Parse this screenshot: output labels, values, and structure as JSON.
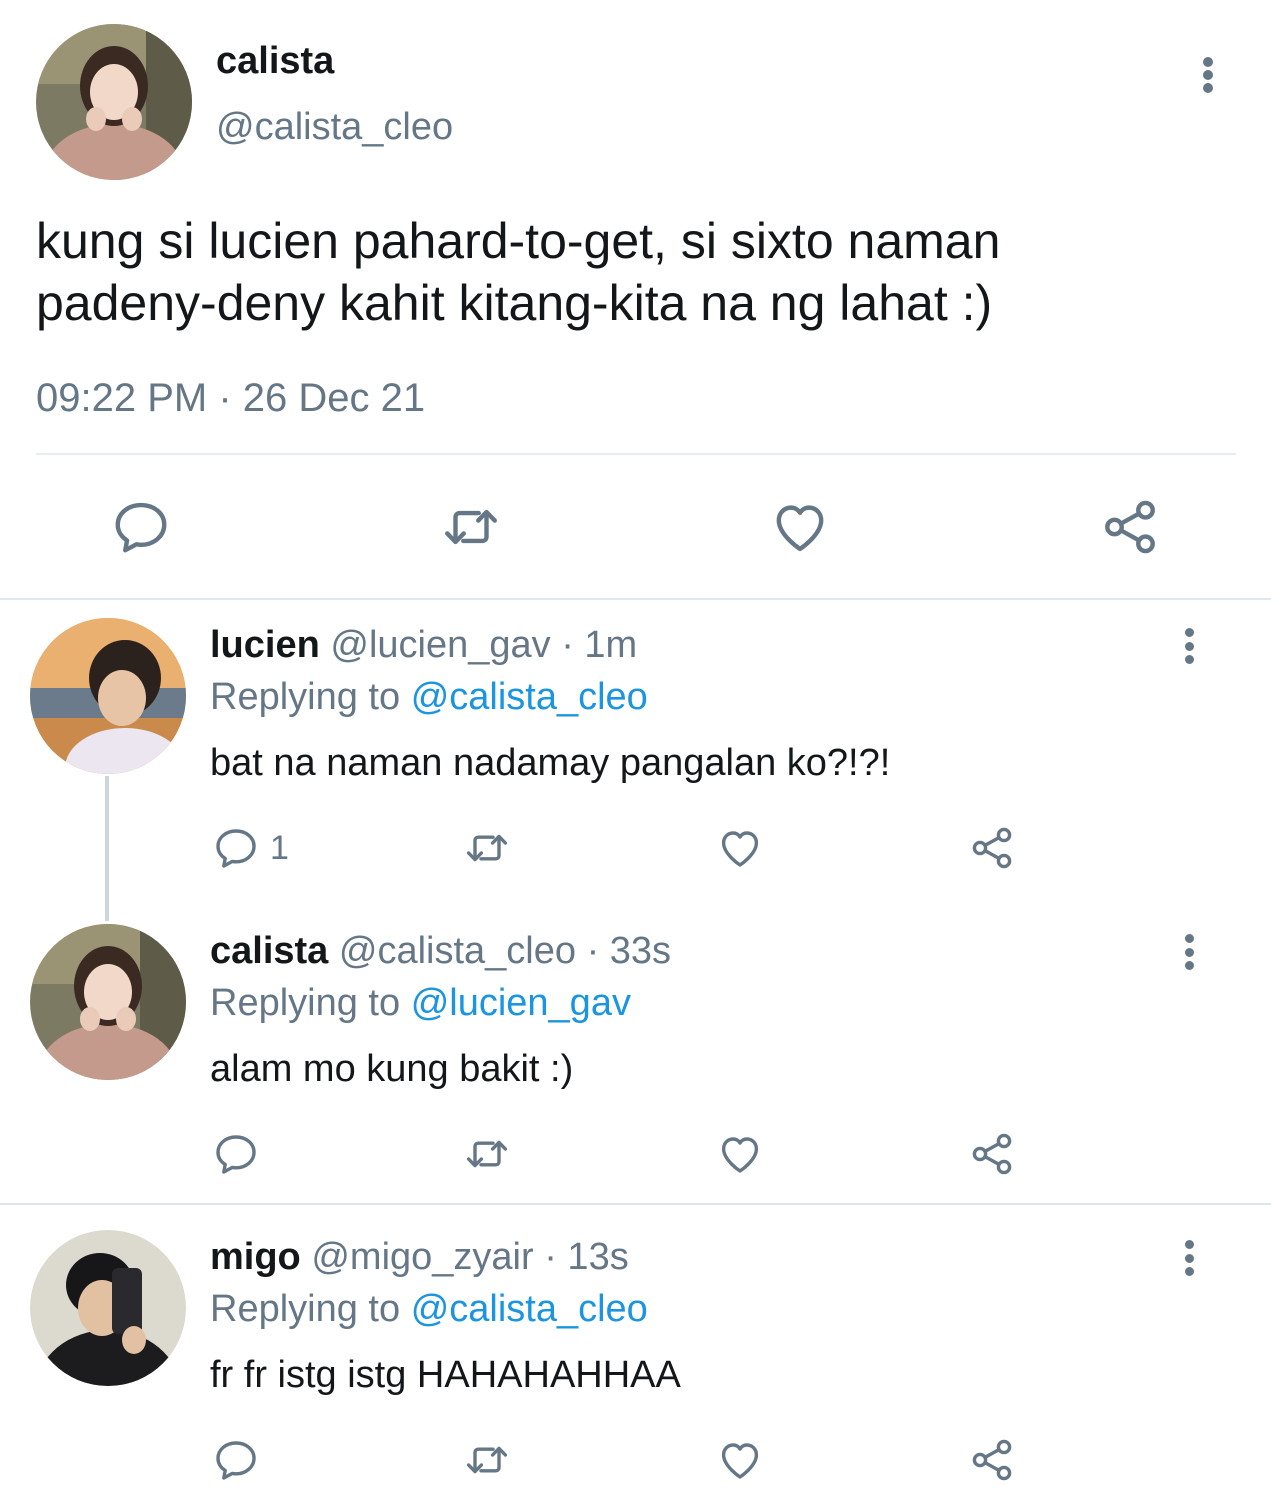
{
  "main_tweet": {
    "name": "calista",
    "handle": "@calista_cleo",
    "text_line1": "kung si lucien pahard-to-get, si sixto naman",
    "text_line2": "padeny-deny kahit kitang-kita na ng lahat :)",
    "timestamp": "09:22 PM · 26 Dec 21",
    "actions": [
      "reply-icon",
      "retweet-icon",
      "like-icon",
      "share-icon"
    ]
  },
  "replies": [
    {
      "name": "lucien",
      "handle": "@lucien_gav",
      "time": "· 1m",
      "replying_prefix": "Replying to",
      "replying_to": "@calista_cleo",
      "text": "bat na naman nadamay pangalan ko?!?!",
      "reply_count": "1"
    },
    {
      "name": "calista",
      "handle": "@calista_cleo",
      "time": "· 33s",
      "replying_prefix": "Replying to",
      "replying_to": "@lucien_gav",
      "text": "alam mo kung bakit :)",
      "reply_count": ""
    },
    {
      "name": "migo",
      "handle": "@migo_zyair",
      "time": "· 13s",
      "replying_prefix": "Replying to",
      "replying_to": "@calista_cleo",
      "text": "fr fr istg istg HAHAHAHHAA",
      "reply_count": ""
    }
  ],
  "colors": {
    "text": "#14171a",
    "secondary": "#657786",
    "mention": "#1b95e0",
    "divider": "#e1e8ed"
  }
}
